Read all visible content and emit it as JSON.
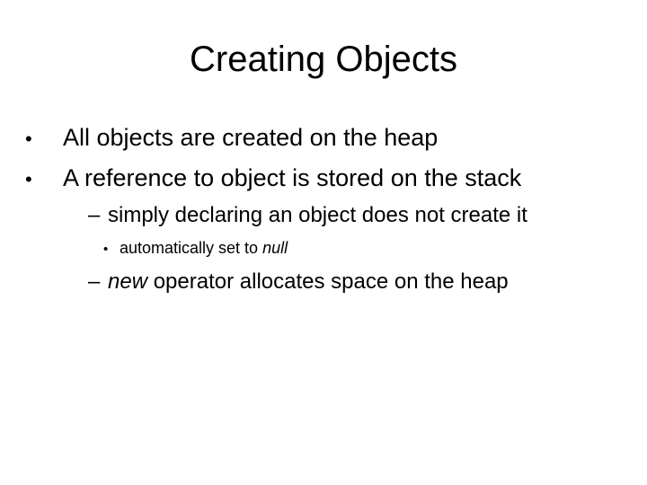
{
  "slide": {
    "title": "Creating Objects",
    "bullets": [
      {
        "level": 1,
        "marker": "•",
        "text": "All objects are created on the heap"
      },
      {
        "level": 1,
        "marker": "•",
        "text": "A reference to object is stored on the stack"
      },
      {
        "level": 2,
        "marker": "–",
        "text": "simply declaring an object does not create it"
      },
      {
        "level": 3,
        "marker": "•",
        "text_before": "automatically set to ",
        "text_italic": "null"
      },
      {
        "level": 2,
        "marker": "–",
        "text_italic": "new",
        "text_after": " operator allocates space on the heap"
      }
    ]
  }
}
